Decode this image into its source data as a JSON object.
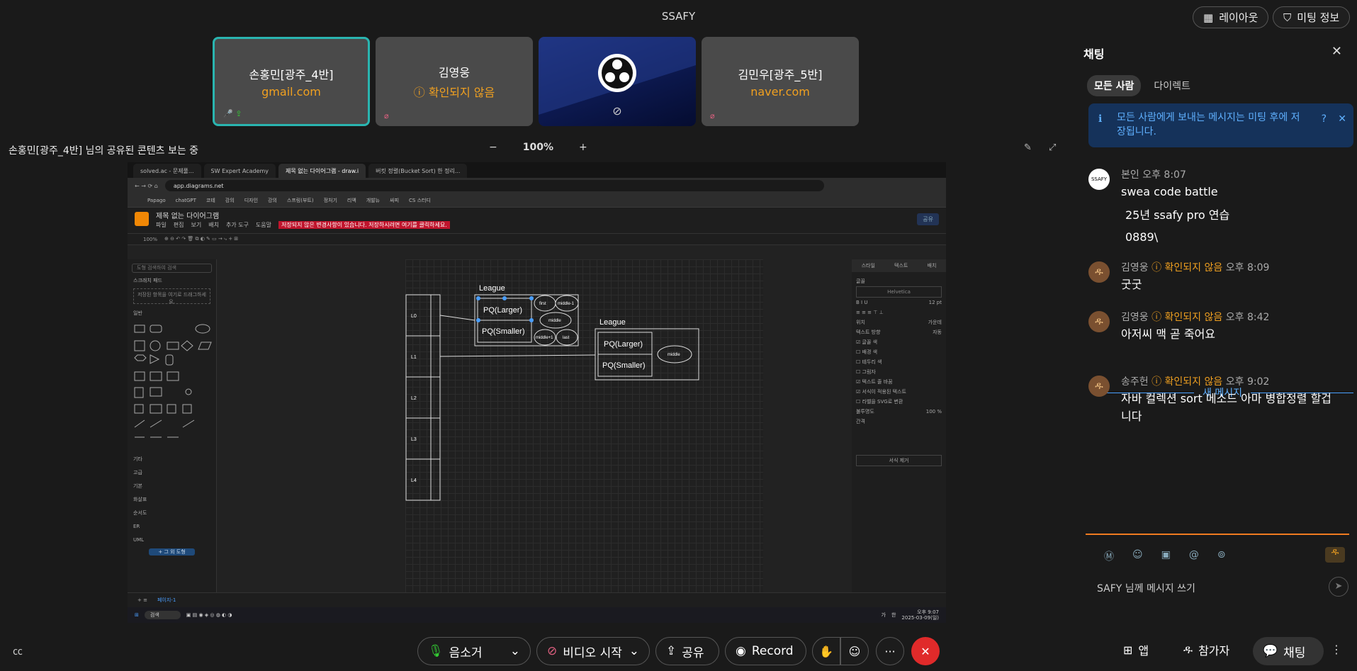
{
  "meeting": {
    "title": "SSAFY",
    "layout_label": "레이아웃",
    "info_label": "미팅 정보"
  },
  "participants": [
    {
      "name": "손홍민[광주_4반]",
      "sub": "gmail.com"
    },
    {
      "name": "김영웅",
      "sub": "확인되지 않음"
    },
    {
      "name": "",
      "sub": ""
    },
    {
      "name": "김민우[광주_5반]",
      "sub": "naver.com"
    }
  ],
  "share": {
    "label": "손홍민[광주_4반] 님의 공유된 콘텐츠 보는 중",
    "zoom": "100%",
    "minus": "−",
    "plus": "+"
  },
  "browser": {
    "tabs": [
      "solved.ac - 문제풀...",
      "SW Expert Academy",
      "제목 없는 다이어그램 - draw.i",
      "버킷 정렬(Bucket Sort) 한 정리..."
    ],
    "url": "app.diagrams.net",
    "bookmarks": [
      "Papago",
      "chatGPT",
      "코테",
      "강의",
      "디자인",
      "강의",
      "스프링(부트)",
      "정처기",
      "리액",
      "개발뉴",
      "싸피",
      "CS 스터디"
    ]
  },
  "drawio": {
    "title": "제목 없는 다이어그램",
    "menu": [
      "파일",
      "편집",
      "보기",
      "배치",
      "추가 도구",
      "도움말"
    ],
    "warning": "저장되지 않은 변경사항이 있습니다. 저장하시려면 여기를 클릭하세요.",
    "share": "공유",
    "zoom": "100%",
    "search_placeholder": "도형 검색하여 검색",
    "scratchpad": "스크래치 패드",
    "scratch_hint": "저장된 항목을 여기로 드래그하세요.",
    "general": "일반",
    "categories": [
      "기타",
      "고급",
      "기본",
      "화살표",
      "순서도",
      "ER",
      "UML"
    ],
    "more_shapes": "+ 그 외 도형",
    "page": "페이지-1",
    "right_tabs": [
      "스타일",
      "텍스트",
      "배치"
    ],
    "right_font_label": "글꼴",
    "right_font": "Helvetica",
    "right_font_size": "12 pt",
    "right_labels": [
      "위치",
      "텍스트 방향",
      "글꼴 색",
      "배경 색",
      "테두리 색",
      "그림자",
      "텍스트 줄 바꿈",
      "서식이 적용된 텍스트",
      "라벨을 SVG로 변환",
      "불투명도",
      "간격"
    ],
    "right_pos": "가운데",
    "right_dir": "자동",
    "right_opacity": "100 %",
    "right_clear": "서식 제거",
    "lanes": [
      "L0",
      "L1",
      "L2",
      "L3",
      "L4"
    ],
    "league": "League",
    "pq_larger": "PQ(Larger)",
    "pq_smaller": "PQ(Smaller)",
    "nodes_a": [
      "first",
      "middle-1",
      "middle",
      "middle+1",
      "last"
    ],
    "node_b": "middle"
  },
  "taskbar": {
    "search": "검색",
    "time": "오후 9:07",
    "date": "2025-03-09(일)",
    "lang": "가",
    "ime": "한"
  },
  "chat": {
    "title": "채팅",
    "tabs": [
      "모든 사람",
      "다이렉트"
    ],
    "notice": "모든 사람에게 보내는 메시지는 미팅 후에 저장됩니다.",
    "messages": [
      {
        "sender": "본인",
        "unverified": "",
        "time": "오후 8:07",
        "lines": [
          "swea code battle",
          "25년 ssafy  pro 연습",
          "0889\\"
        ]
      },
      {
        "sender": "김영웅",
        "unverified": "확인되지 않음",
        "time": "오후 8:09",
        "lines": [
          "굿굿"
        ]
      },
      {
        "sender": "김영웅",
        "unverified": "확인되지 않음",
        "time": "오후 8:42",
        "lines": [
          "아저씨 맥 곧 죽어요"
        ]
      },
      {
        "sender": "송주헌",
        "unverified": "확인되지 않음",
        "time": "오후 9:02",
        "lines": [
          "자바 컬렉션 sort 메소드 아마 병합정렬 할겁니다"
        ]
      }
    ],
    "new_messages": "새 메시지",
    "input_placeholder": "SAFY 님께 메시지 쓰기"
  },
  "controls": {
    "mute": "음소거",
    "video": "비디오 시작",
    "share": "공유",
    "record": "Record",
    "apps": "앱",
    "participants": "참가자",
    "chat": "채팅"
  },
  "colors": {
    "accent": "#2ab5b0",
    "unverified": "#f0a020",
    "leave": "#e02a2a",
    "notice_bg": "#15325a"
  }
}
